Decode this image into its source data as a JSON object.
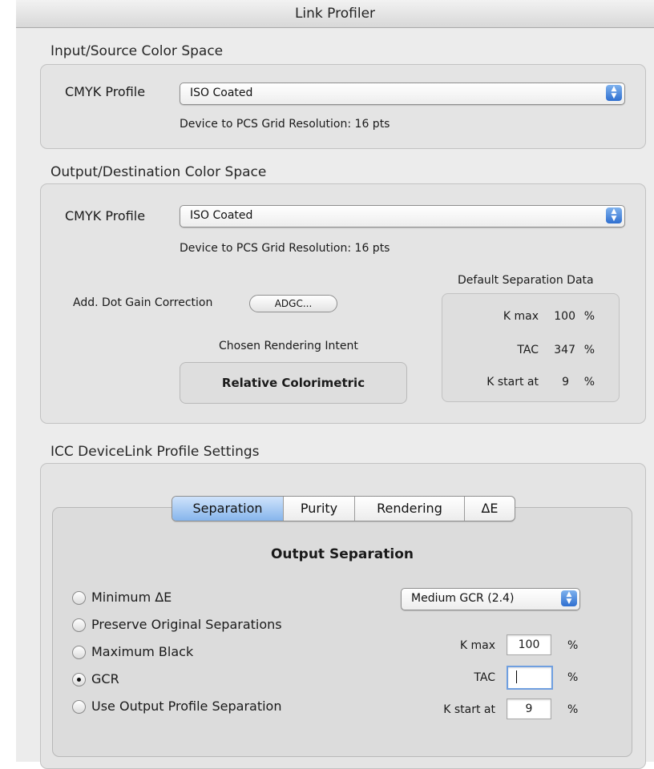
{
  "window": {
    "title": "Link Profiler"
  },
  "input_section": {
    "title": "Input/Source Color Space",
    "cmyk_label": "CMYK Profile",
    "cmyk_value": "ISO Coated",
    "grid_resolution": "Device to PCS Grid Resolution: 16 pts"
  },
  "output_section": {
    "title": "Output/Destination Color Space",
    "cmyk_label": "CMYK Profile",
    "cmyk_value": "ISO Coated",
    "grid_resolution": "Device to PCS Grid Resolution: 16 pts",
    "dot_gain_label": "Add. Dot Gain Correction",
    "adgc_button": "ADGC...",
    "intent_label": "Chosen Rendering Intent",
    "intent_value": "Relative Colorimetric",
    "default_sep": {
      "title": "Default Separation Data",
      "rows": [
        {
          "label": "K max",
          "value": "100",
          "unit": "%"
        },
        {
          "label": "TAC",
          "value": "347",
          "unit": "%"
        },
        {
          "label": "K start at",
          "value": "9",
          "unit": "%"
        }
      ]
    }
  },
  "devicelink_section": {
    "title": "ICC DeviceLink Profile Settings",
    "tabs": [
      "Separation",
      "Purity",
      "Rendering",
      "ΔE"
    ],
    "active_tab": "Separation",
    "panel_title": "Output Separation",
    "options": [
      {
        "label": "Minimum ΔE",
        "selected": false
      },
      {
        "label": "Preserve Original Separations",
        "selected": false
      },
      {
        "label": "Maximum Black",
        "selected": false
      },
      {
        "label": "GCR",
        "selected": true
      },
      {
        "label": "Use Output Profile Separation",
        "selected": false
      }
    ],
    "gcr_select": "Medium GCR (2.4)",
    "fields": [
      {
        "label": "K max",
        "value": "100",
        "unit": "%"
      },
      {
        "label": "TAC",
        "value": "",
        "unit": "%"
      },
      {
        "label": "K start at",
        "value": "9",
        "unit": "%"
      }
    ]
  },
  "colors": {
    "accent": "#3a7bd5",
    "tab_active": "#9cc3ef",
    "panel": "#e4e4e4"
  }
}
